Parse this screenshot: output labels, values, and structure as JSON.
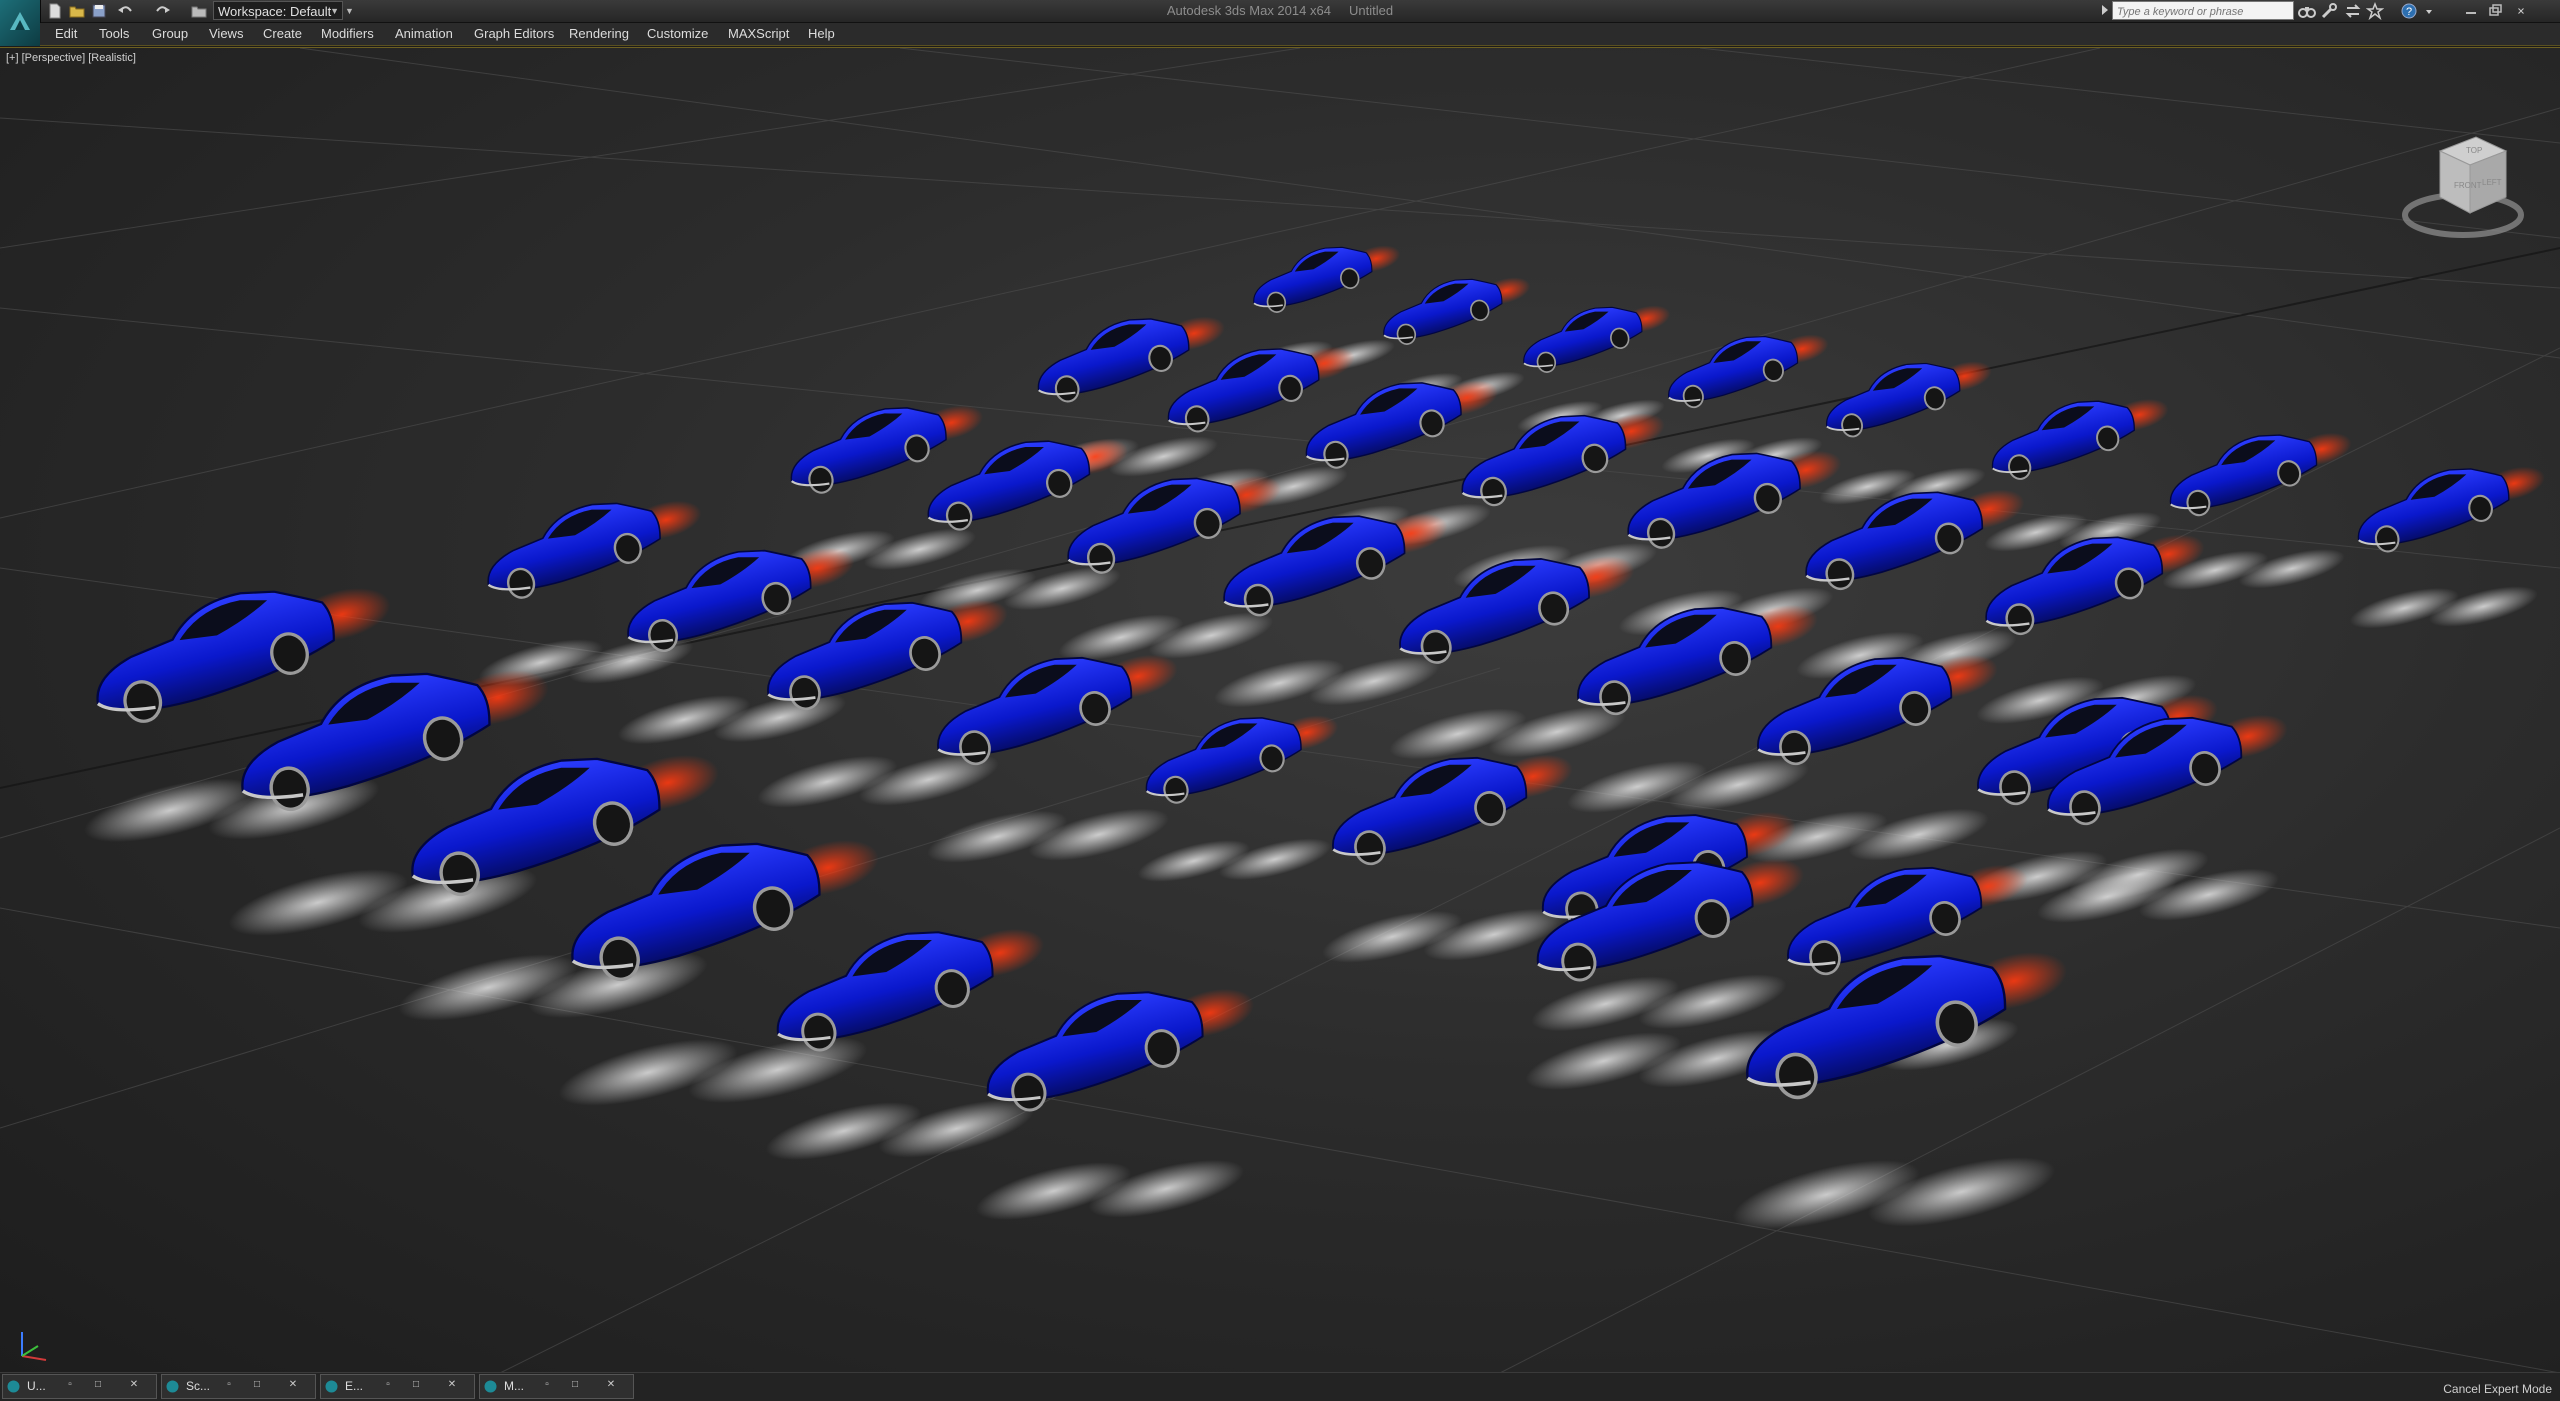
{
  "titlebar": {
    "app_title": "Autodesk 3ds Max 2014 x64",
    "doc_title": "Untitled",
    "workspace_label": "Workspace: Default",
    "search_placeholder": "Type a keyword or phrase",
    "icons": [
      "app-logo-icon",
      "new-file-icon",
      "open-file-icon",
      "save-icon",
      "undo-icon",
      "redo-icon",
      "project-folder-icon",
      "binoculars-icon",
      "tools-icon",
      "exchange-icon",
      "star-icon",
      "help-icon",
      "minimize-icon",
      "restore-icon",
      "close-icon"
    ]
  },
  "menu": {
    "items": [
      "Edit",
      "Tools",
      "Group",
      "Views",
      "Create",
      "Modifiers",
      "Animation",
      "Graph Editors",
      "Rendering",
      "Customize",
      "MAXScript",
      "Help"
    ]
  },
  "viewport": {
    "label": "[+] [Perspective] [Realistic]",
    "viewcube_faces": [
      "FRONT",
      "LEFT",
      "TOP"
    ],
    "car_color": "#0a1bd6",
    "light_color": "#ff3a10",
    "ground_color": "#2f2f2f"
  },
  "taskbar": {
    "tabs": [
      "U...",
      "Sc...",
      "E...",
      "M..."
    ]
  },
  "status": {
    "text": "Cancel Expert Mode"
  },
  "colors": {
    "accent_line": "#6d5f22",
    "teal_icon": "#1d6e78"
  }
}
